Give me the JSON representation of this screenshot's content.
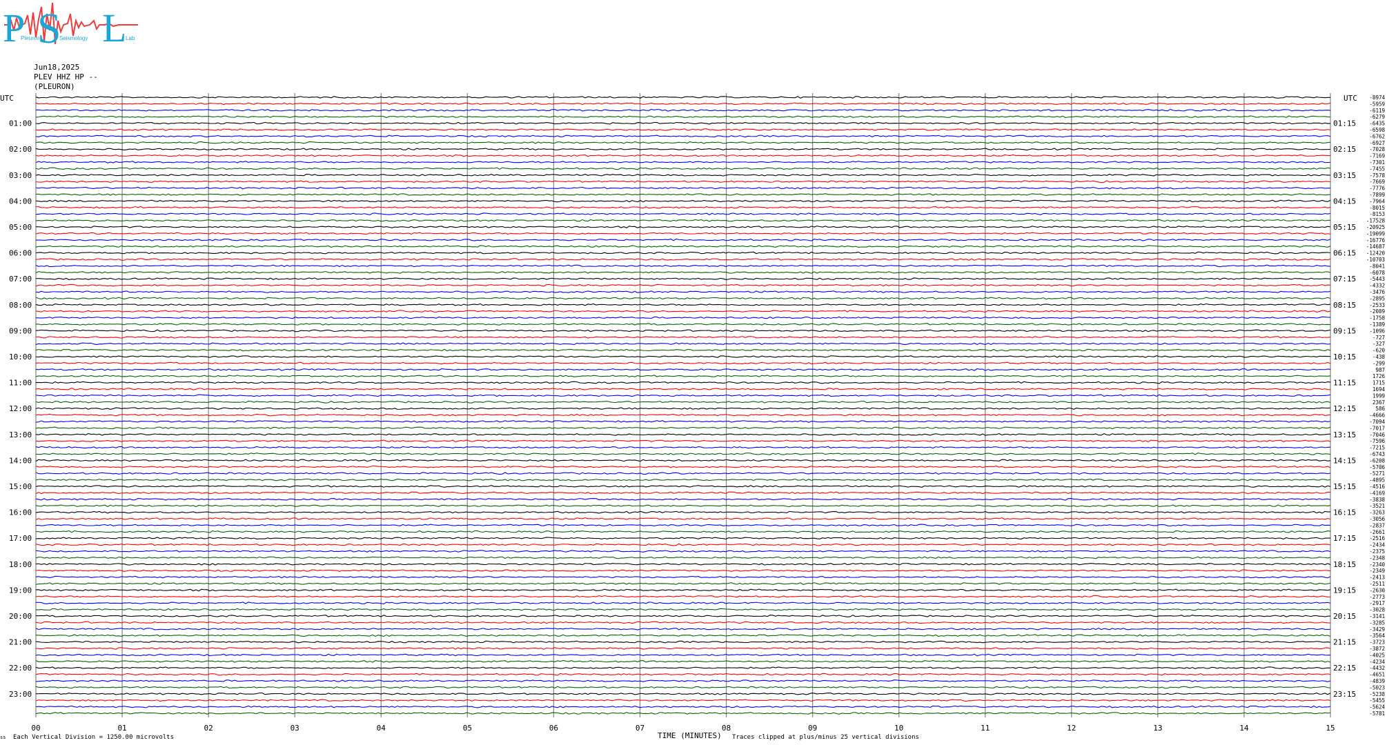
{
  "logo": {
    "letters": [
      "P",
      "S",
      "L"
    ],
    "words": [
      "Pleuron",
      "Seismology",
      "Lab"
    ],
    "colors": {
      "letters": "#1ba6d6",
      "wave": "#ef3b3b"
    }
  },
  "header": {
    "date": "Jun18,2025",
    "station": "PLEV HHZ HP --",
    "site": "(PLEURON)"
  },
  "axis": {
    "left_title": "UTC",
    "right_title": "UTC",
    "x_label": "TIME (MINUTES)"
  },
  "footer": {
    "scale_mark": "ss",
    "scale_note": "Each Vertical Division = 1250.00 microvolts",
    "clip_note": "Traces clipped at plus/minus 25 vertical divisions"
  },
  "chart_data": {
    "type": "line",
    "x_range": [
      0,
      15
    ],
    "x_ticks": [
      "00",
      "01",
      "02",
      "03",
      "04",
      "05",
      "06",
      "07",
      "08",
      "09",
      "10",
      "11",
      "12",
      "13",
      "14",
      "15"
    ],
    "grid": true,
    "left_hour_labels": [
      "01:00",
      "02:00",
      "03:00",
      "04:00",
      "05:00",
      "06:00",
      "07:00",
      "08:00",
      "09:00",
      "10:00",
      "11:00",
      "12:00",
      "13:00",
      "14:00",
      "15:00",
      "16:00",
      "17:00",
      "18:00",
      "19:00",
      "20:00",
      "21:00",
      "22:00",
      "23:00"
    ],
    "right_hour_labels": [
      "01:15",
      "02:15",
      "03:15",
      "04:15",
      "05:15",
      "06:15",
      "07:15",
      "08:15",
      "09:15",
      "10:15",
      "11:15",
      "12:15",
      "13:15",
      "14:15",
      "15:15",
      "16:15",
      "17:15",
      "18:15",
      "19:15",
      "20:15",
      "21:15",
      "22:15",
      "23:15"
    ],
    "trace_colors": [
      "#000000",
      "#ff0000",
      "#0000ff",
      "#006600"
    ],
    "trace_count": 96,
    "trace_minutes": 15,
    "trace_offsets": [
      "-8974",
      "-5959",
      "-6119",
      "-6279",
      "-6435",
      "-6598",
      "-6762",
      "-6927",
      "-7028",
      "-7169",
      "-7301",
      "-7455",
      "-7578",
      "-7669",
      "-7776",
      "-7899",
      "-7964",
      "-8015",
      "-8153",
      "-17528",
      "-20925",
      "-19099",
      "-16776",
      "-14687",
      "-12420",
      "-10703",
      "-8041",
      "-6078",
      "-5443",
      "-4332",
      "-3476",
      "-2895",
      "-2533",
      "-2089",
      "-1758",
      "-1389",
      "-1096",
      "-727",
      "-327",
      "-620",
      "-438",
      "-299",
      "987",
      "1726",
      "1715",
      "1694",
      "1999",
      "2367",
      "586",
      "-4666",
      "-7094",
      "-7017",
      "-7046",
      "-7596",
      "-7215",
      "-6743",
      "-6208",
      "-5706",
      "-5271",
      "-4895",
      "-4516",
      "-4169",
      "-3838",
      "-3521",
      "-3263",
      "-3056",
      "-2837",
      "-2661",
      "-2516",
      "-2434",
      "-2375",
      "-2348",
      "-2340",
      "-2349",
      "-2413",
      "-2511",
      "-2630",
      "-2773",
      "-2917",
      "-3028",
      "-3141",
      "-3285",
      "-3429",
      "-3564",
      "-3723",
      "-3872",
      "-4025",
      "-4234",
      "-4432",
      "-4651",
      "-4839",
      "-5023",
      "-5238",
      "-5455",
      "-5624",
      "-5781"
    ],
    "scale_microvolts_per_division": 1250,
    "clip_divisions": 25
  }
}
